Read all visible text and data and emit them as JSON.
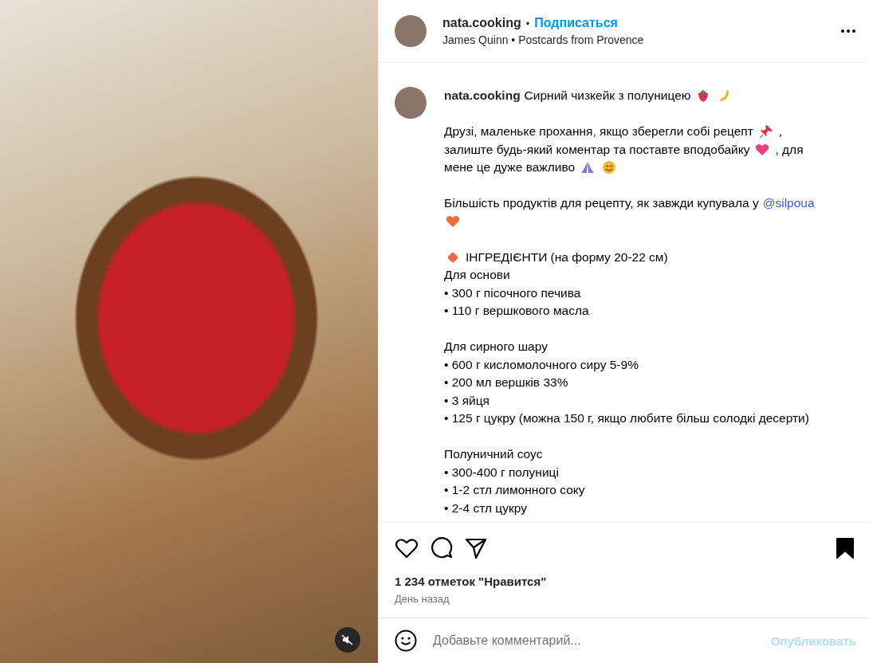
{
  "header": {
    "username": "nata.cooking",
    "separator": "•",
    "follow": "Подписаться",
    "subtitle": "James Quinn • Postcards from Provence"
  },
  "caption": {
    "paragraphs": [
      [
        [
          {
            "kind": "author",
            "text": "nata.cooking"
          },
          {
            "kind": "text",
            "text": "Сирний чизкейк з полуницею"
          },
          {
            "kind": "strawberry"
          },
          {
            "kind": "hand"
          }
        ]
      ],
      [
        [
          {
            "kind": "text",
            "text": "Друзі, маленьке прохання, якщо зберегли собі рецепт"
          },
          {
            "kind": "pin"
          },
          {
            "kind": "text",
            "text": ","
          }
        ],
        [
          {
            "kind": "text",
            "text": "залиште будь-який коментар та поставте вподобайку"
          },
          {
            "kind": "heart"
          },
          {
            "kind": "text",
            "text": ", для"
          }
        ],
        [
          {
            "kind": "text",
            "text": "мене це дуже важливо"
          },
          {
            "kind": "pray"
          },
          {
            "kind": "smile"
          }
        ]
      ],
      [
        [
          {
            "kind": "text",
            "text": "Більшість продуктів для рецепту, як завжди купувала у"
          },
          {
            "kind": "mention",
            "text": "@silpoua"
          }
        ],
        [
          {
            "kind": "orange-heart"
          }
        ]
      ],
      [
        [
          {
            "kind": "diamond"
          },
          {
            "kind": "text",
            "text": "ІНГРЕДІЄНТИ (на форму 20-22 см)"
          }
        ],
        [
          {
            "kind": "text",
            "text": "Для основи"
          }
        ],
        [
          {
            "kind": "text",
            "text": "• 300 г пісочного печива"
          }
        ],
        [
          {
            "kind": "text",
            "text": "• 110 г вершкового масла"
          }
        ]
      ],
      [
        [
          {
            "kind": "text",
            "text": "Для сирного шару"
          }
        ],
        [
          {
            "kind": "text",
            "text": "• 600 г кисломолочного сиру 5-9%"
          }
        ],
        [
          {
            "kind": "text",
            "text": "• 200 мл вершків 33%"
          }
        ],
        [
          {
            "kind": "text",
            "text": "• 3 яйця"
          }
        ],
        [
          {
            "kind": "text",
            "text": "• 125 г цукру (можна 150 г, якщо любите більш солодкі десерти)"
          }
        ]
      ],
      [
        [
          {
            "kind": "text",
            "text": "Полуничний соус"
          }
        ],
        [
          {
            "kind": "text",
            "text": "• 300-400 г полуниці"
          }
        ],
        [
          {
            "kind": "text",
            "text": "• 1-2 стл лимонного соку"
          }
        ],
        [
          {
            "kind": "text",
            "text": "• 2-4 стл цукру"
          }
        ]
      ]
    ]
  },
  "actions": {
    "liked": false,
    "saved": true
  },
  "likes": "1 234 отметок \"Нравится\"",
  "time": "День назад",
  "comment": {
    "placeholder": "Добавьте комментарий...",
    "post_button": {
      "label": "Опубликовать",
      "disabled": true
    }
  },
  "media": {
    "muted": true
  }
}
